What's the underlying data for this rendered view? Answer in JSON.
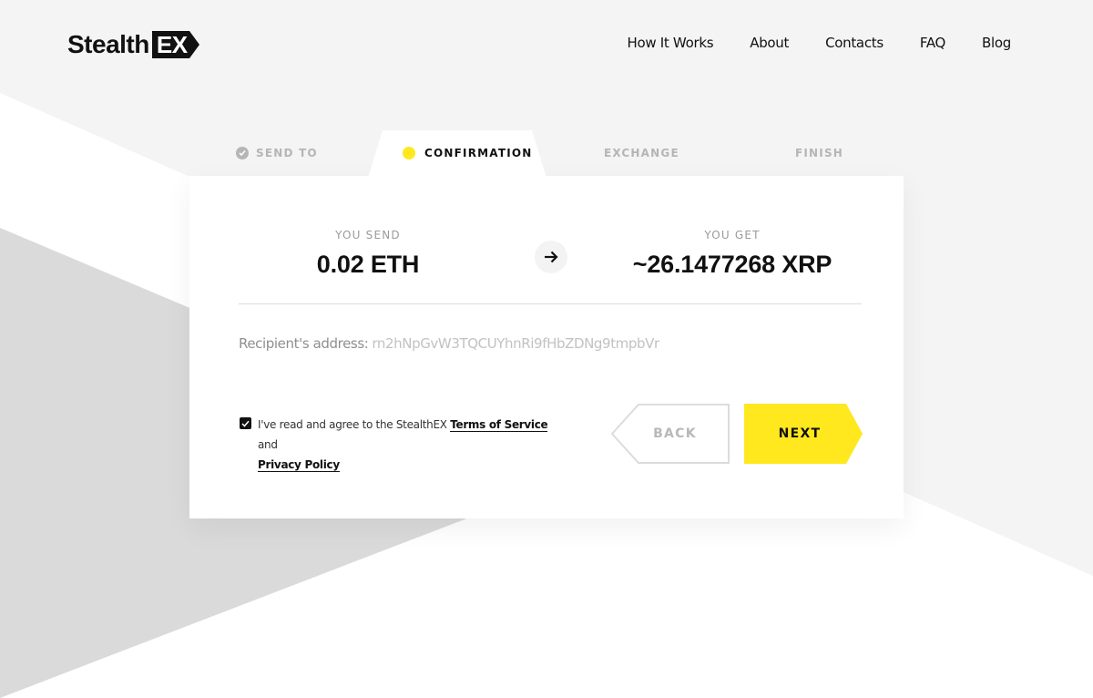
{
  "brand": {
    "word": "Stealth",
    "badge": "EX"
  },
  "nav": [
    "How It Works",
    "About",
    "Contacts",
    "FAQ",
    "Blog"
  ],
  "steps": {
    "send_to": "SEND TO",
    "confirmation": "CONFIRMATION",
    "exchange": "EXCHANGE",
    "finish": "FINISH"
  },
  "exchange": {
    "send_label": "YOU SEND",
    "send_value": "0.02 ETH",
    "get_label": "YOU GET",
    "get_value": "~26.1477268 XRP"
  },
  "recipient": {
    "label": "Recipient's address:",
    "address": "rn2hNpGvW3TQCUYhnRi9fHbZDNg9tmpbVr"
  },
  "agreement": {
    "checked": true,
    "text_before": "I've read and agree to the StealthEX",
    "terms_link": "Terms of Service",
    "text_and": "and",
    "privacy_link": "Privacy Policy"
  },
  "buttons": {
    "back": "BACK",
    "next": "NEXT"
  },
  "colors": {
    "accent": "#ffe81e",
    "text": "#111111",
    "muted": "#b5b5b5"
  }
}
